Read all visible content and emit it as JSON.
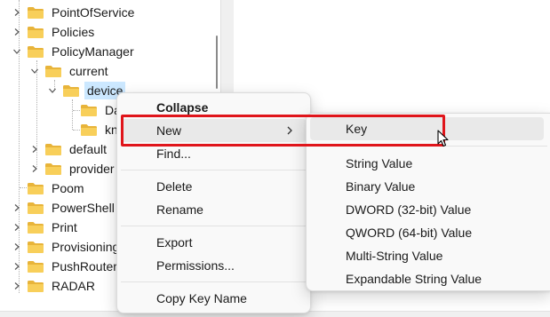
{
  "tree": {
    "items": [
      {
        "label": "PointOfService",
        "expander": "collapsed"
      },
      {
        "label": "Policies",
        "expander": "collapsed"
      },
      {
        "label": "PolicyManager",
        "expander": "expanded"
      },
      {
        "label": "current",
        "expander": "expanded"
      },
      {
        "label": "device",
        "expander": "expanded",
        "selected": true
      },
      {
        "label": "Da",
        "expander": "none"
      },
      {
        "label": "kn",
        "expander": "none"
      },
      {
        "label": "default",
        "expander": "collapsed"
      },
      {
        "label": "provider",
        "expander": "collapsed"
      },
      {
        "label": "Poom",
        "expander": "none"
      },
      {
        "label": "PowerShell",
        "expander": "collapsed"
      },
      {
        "label": "Print",
        "expander": "collapsed"
      },
      {
        "label": "Provisioning",
        "expander": "collapsed"
      },
      {
        "label": "PushRouter",
        "expander": "collapsed"
      },
      {
        "label": "RADAR",
        "expander": "collapsed"
      }
    ]
  },
  "context_menu": {
    "collapse": "Collapse",
    "new": "New",
    "find": "Find...",
    "delete": "Delete",
    "rename": "Rename",
    "export": "Export",
    "permissions": "Permissions...",
    "copy_key_name": "Copy Key Name"
  },
  "submenu": {
    "key": "Key",
    "string_value": "String Value",
    "binary_value": "Binary Value",
    "dword_value": "DWORD (32-bit) Value",
    "qword_value": "QWORD (64-bit) Value",
    "multi_string_value": "Multi-String Value",
    "expandable_string_value": "Expandable String Value"
  },
  "colors": {
    "folder": "#f4c542",
    "selection": "#cce8ff",
    "highlight_outline": "#e0151b",
    "menu_background": "#f9f9f9",
    "menu_hover": "#e9e9e9"
  },
  "icons": {
    "folder": "folder-icon",
    "expand": "chevron-right-icon",
    "collapse": "chevron-down-icon",
    "submenu_arrow": "chevron-right-icon",
    "cursor": "mouse-pointer-icon"
  }
}
